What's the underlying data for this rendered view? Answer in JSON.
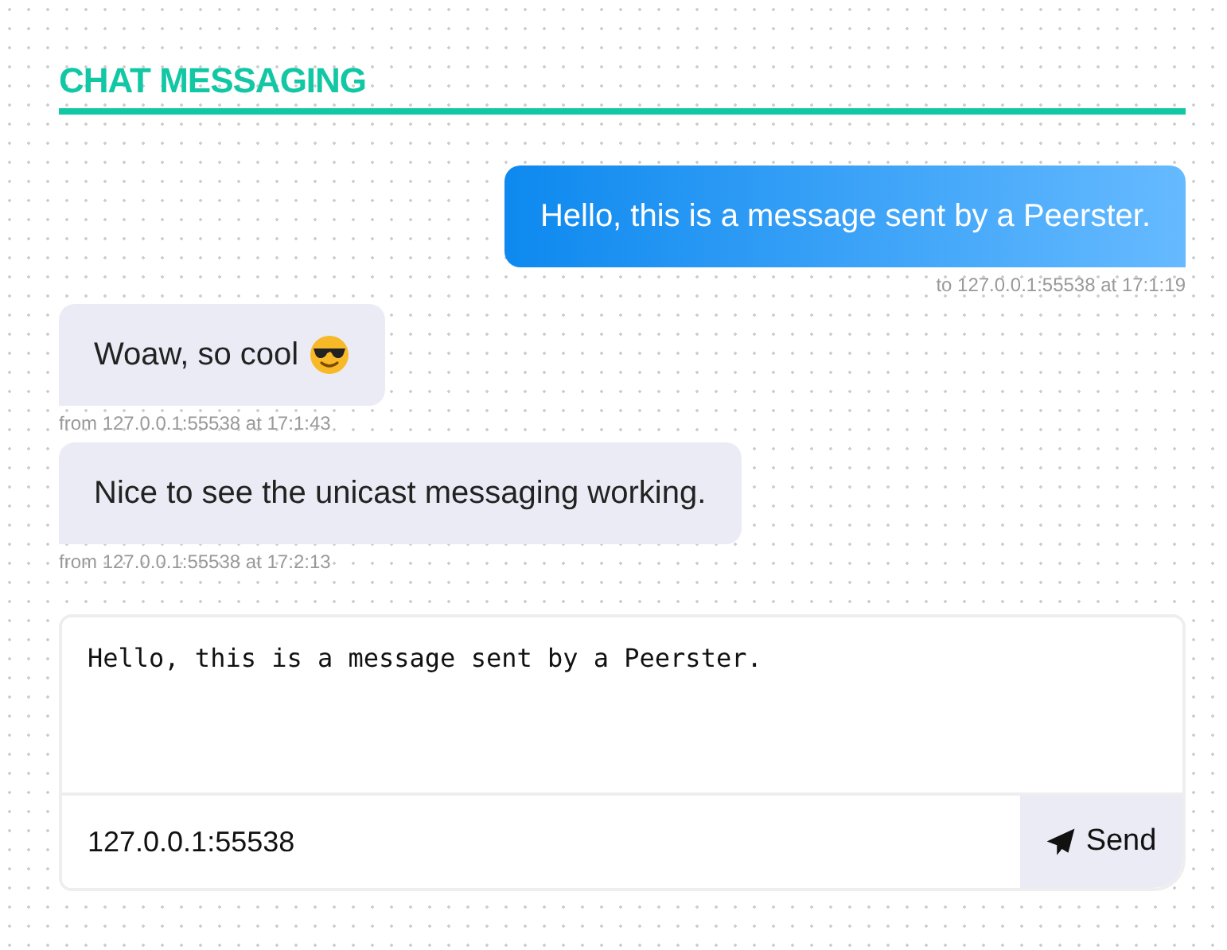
{
  "title": "CHAT MESSAGING",
  "messages": [
    {
      "kind": "sent",
      "text": "Hello, this is a message sent by a Peerster.",
      "emoji": false,
      "meta": "to 127.0.0.1:55538 at 17:1:19"
    },
    {
      "kind": "received",
      "text": "Woaw, so cool",
      "emoji": true,
      "meta": "from 127.0.0.1:55538 at 17:1:43"
    },
    {
      "kind": "received",
      "text": "Nice to see the unicast messaging working.",
      "emoji": false,
      "meta": "from 127.0.0.1:55538 at 17:2:13"
    }
  ],
  "composer": {
    "message": "Hello, this is a message sent by a Peerster.",
    "destination": "127.0.0.1:55538",
    "send_label": "Send"
  }
}
